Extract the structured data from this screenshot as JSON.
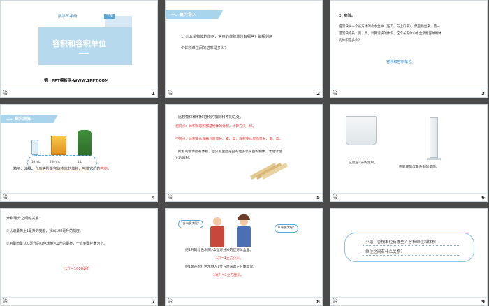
{
  "footer_logo_text": "治",
  "slides": {
    "s1": {
      "number": "1",
      "grade": "数学五年级",
      "volume": "下册",
      "title": "容积和容积单位",
      "credit": "第一PPT模板网-WWW.1PPT.COM"
    },
    "s2": {
      "number": "2",
      "header": "一、复习导入",
      "lines": [
        "1. 什么是物体的体积，常用的体积单位有哪些？每相邻两",
        "个体积单位间的进率是多少？"
      ]
    },
    "s3": {
      "number": "3",
      "lines": [
        "2. 实验。",
        "把泥块从一个长方体的小水盒中（压实，与上口平），然后扣出来，量一",
        "量泥块的长、宽、高，计算泥块的体积。这个长方体小水盒所能容纳物体",
        "的体积是多少？"
      ],
      "note": "容积和容积单位。"
    },
    "s4": {
      "number": "4",
      "header": "二、探究新知",
      "labels": [
        "10 mL",
        "250 mL",
        "1 L"
      ],
      "caption_prefix": "箱子、油桶、仓库等所能容纳物体的体积，叫做它们的",
      "caption_key": "容积",
      "caption_suffix": "。"
    },
    "s5": {
      "number": "5",
      "intro": "比较物体体积和容积的相同和不同之处。",
      "same": "相同点：体积和容积都是物体的体积，计算方法一样。",
      "diff": "不同点：体积要从容器外面量长、宽、高；容积要从里面量长、宽、高。",
      "note1": "所有的物体都有体积，但只有里面是空的能够装东西的物体，才能计量",
      "note2": "它的容积。"
    },
    "s6": {
      "number": "6",
      "left": "这就是1升的量杯。",
      "right": "这就是刻度是升制的量筒。"
    },
    "s7": {
      "number": "7",
      "title": "升和毫升之间的关系：",
      "item1": "①认识量筒上1毫升的刻度，找出100毫升的刻度。",
      "item2": "②用量筒量100毫升的红色水倒入1升的量杯，一直到量杯满为止。",
      "result": "1升=1000毫升"
    },
    "s8": {
      "number": "8",
      "bubble_left": "1升有多大呢？",
      "bubble_right": "1L有多大呢？",
      "line1": "把1升的红色水倒入1立方分米的正方体盒里。",
      "result1": "1升=1立方分米。",
      "line2": "把1毫升的红色水倒入1立方厘米的正方体盒里。",
      "result2": "1毫升=1立方厘米。"
    },
    "s9": {
      "number": "9",
      "line1": "小结：容积单位有哪些？容积单位和体积",
      "line2": "单位之间有什么关系？"
    }
  },
  "colors": {
    "accent_blue": "#a8d4ec",
    "red": "#e53935",
    "blue_text": "#1e88e5"
  }
}
